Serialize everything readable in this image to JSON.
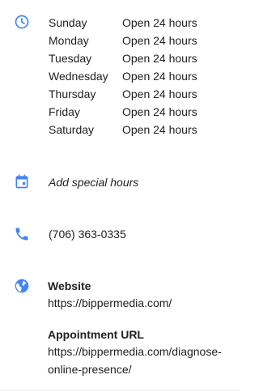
{
  "hours": [
    {
      "day": "Sunday",
      "value": "Open 24 hours"
    },
    {
      "day": "Monday",
      "value": "Open 24 hours"
    },
    {
      "day": "Tuesday",
      "value": "Open 24 hours"
    },
    {
      "day": "Wednesday",
      "value": "Open 24 hours"
    },
    {
      "day": "Thursday",
      "value": "Open 24 hours"
    },
    {
      "day": "Friday",
      "value": "Open 24 hours"
    },
    {
      "day": "Saturday",
      "value": "Open 24 hours"
    }
  ],
  "special_hours": {
    "label": "Add special hours",
    "icon": "calendar-icon"
  },
  "phone": {
    "number": "(706) 363-0335",
    "icon": "phone-icon"
  },
  "website": {
    "label": "Website",
    "url": "https://bippermedia.com/",
    "icon": "globe-icon"
  },
  "appointment": {
    "label": "Appointment URL",
    "url_line1": "https://bippermedia.com/diagnose-",
    "url_line2": "online-presence/"
  },
  "hours_icon": "clock-icon",
  "colors": {
    "icon_blue": "#4285f4",
    "text": "#202124",
    "divider": "#e8eaed"
  }
}
